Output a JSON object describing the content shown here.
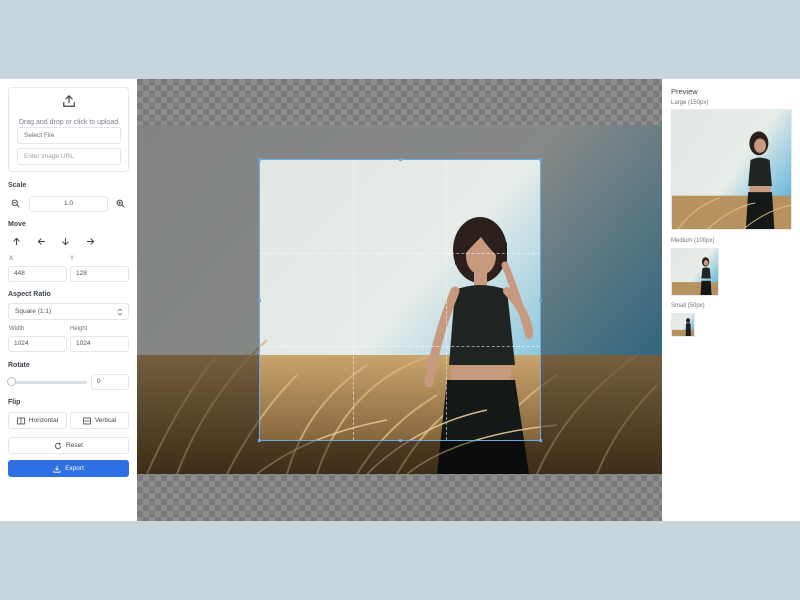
{
  "upload": {
    "hint": "Drag and drop or click to upload",
    "select_file": "Select File",
    "url_placeholder": "Enter image URL"
  },
  "scale": {
    "label": "Scale",
    "value": "1.0"
  },
  "move": {
    "label": "Move",
    "x_label": "X",
    "x_value": "448",
    "y_label": "Y",
    "y_value": "128"
  },
  "aspect": {
    "label": "Aspect Ratio",
    "selected": "Square (1:1)",
    "width_label": "Width",
    "width_value": "1024",
    "height_label": "Height",
    "height_value": "1024"
  },
  "rotate": {
    "label": "Rotate",
    "value": "0",
    "level": 0
  },
  "flip": {
    "label": "Flip",
    "horizontal": "Horizontal",
    "vertical": "Vertical"
  },
  "reset_label": "Reset",
  "export_label": "Export",
  "preview": {
    "title": "Preview",
    "large": "Large (150px)",
    "medium": "Medium (100px)",
    "small": "Small (50px)"
  },
  "colors": {
    "accent": "#2f6fe4",
    "crop_border": "#6aa8e6",
    "background": "#c6d6dc"
  },
  "icons": [
    "upload-icon",
    "zoom-out-icon",
    "zoom-in-icon",
    "arrow-up-icon",
    "arrow-left-icon",
    "arrow-down-icon",
    "arrow-right-icon",
    "chevron-updown-icon",
    "flip-horizontal-icon",
    "flip-vertical-icon",
    "reset-icon",
    "download-icon"
  ]
}
